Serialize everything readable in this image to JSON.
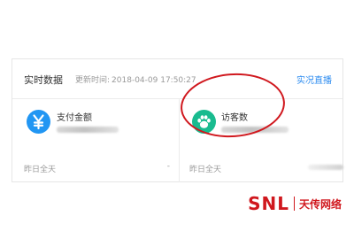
{
  "panel": {
    "title": "实时数据",
    "update_label": "更新时间:",
    "update_time": "2018-04-09 17:50:27",
    "live_link": "实况直播"
  },
  "cards": [
    {
      "icon": "yen-icon",
      "icon_color": "#2196f3",
      "label": "支付金额",
      "yesterday_label": "昨日全天",
      "yesterday_value": "-"
    },
    {
      "icon": "paw-icon",
      "icon_color": "#19bb8f",
      "label": "访客数",
      "yesterday_label": "昨日全天"
    }
  ],
  "annotation": {
    "color": "#d0181e"
  },
  "watermark": {
    "latin": "SNL",
    "cjk": "天传网络",
    "color": "#d0181e"
  }
}
